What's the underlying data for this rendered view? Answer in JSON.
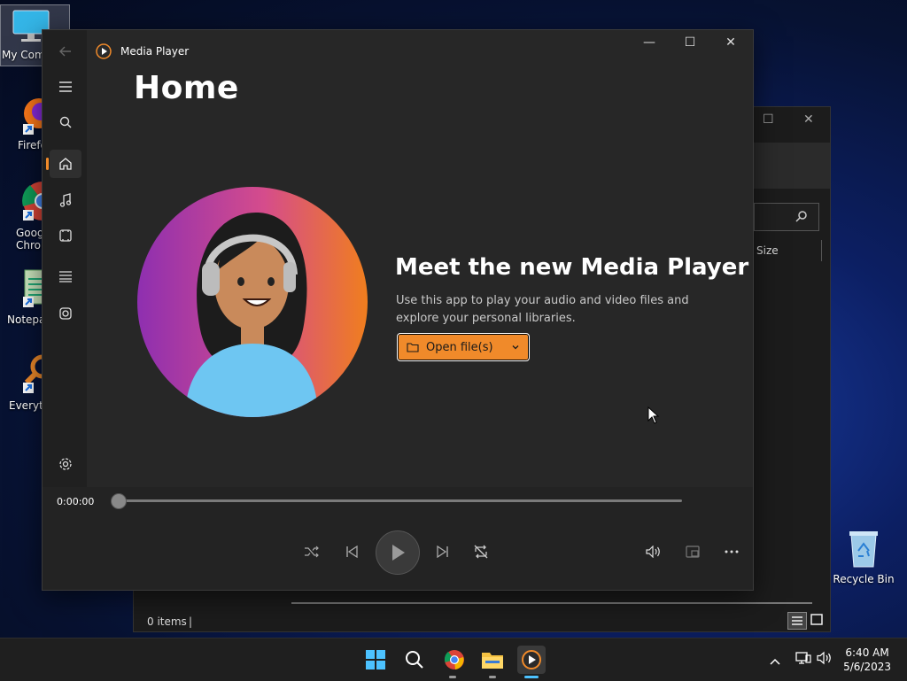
{
  "desktop": {
    "icons": [
      {
        "label": "My Com"
      },
      {
        "label": "Firefo"
      },
      {
        "label": "Goog\nChron"
      },
      {
        "label": "Notepa"
      },
      {
        "label": "Everyth"
      },
      {
        "label": "Recycle Bin"
      }
    ]
  },
  "explorer": {
    "size_column": "Size",
    "status": "0 items"
  },
  "player": {
    "title": "Media Player",
    "home_title": "Home",
    "hero_title": "Meet the new Media Player",
    "hero_description": "Use this app to play your audio and video files and explore your personal libraries.",
    "open_button": "Open file(s)",
    "timecode": "0:00:00",
    "accent": "#f08a2a"
  },
  "taskbar": {
    "time": "6:40 AM",
    "date": "5/6/2023"
  }
}
